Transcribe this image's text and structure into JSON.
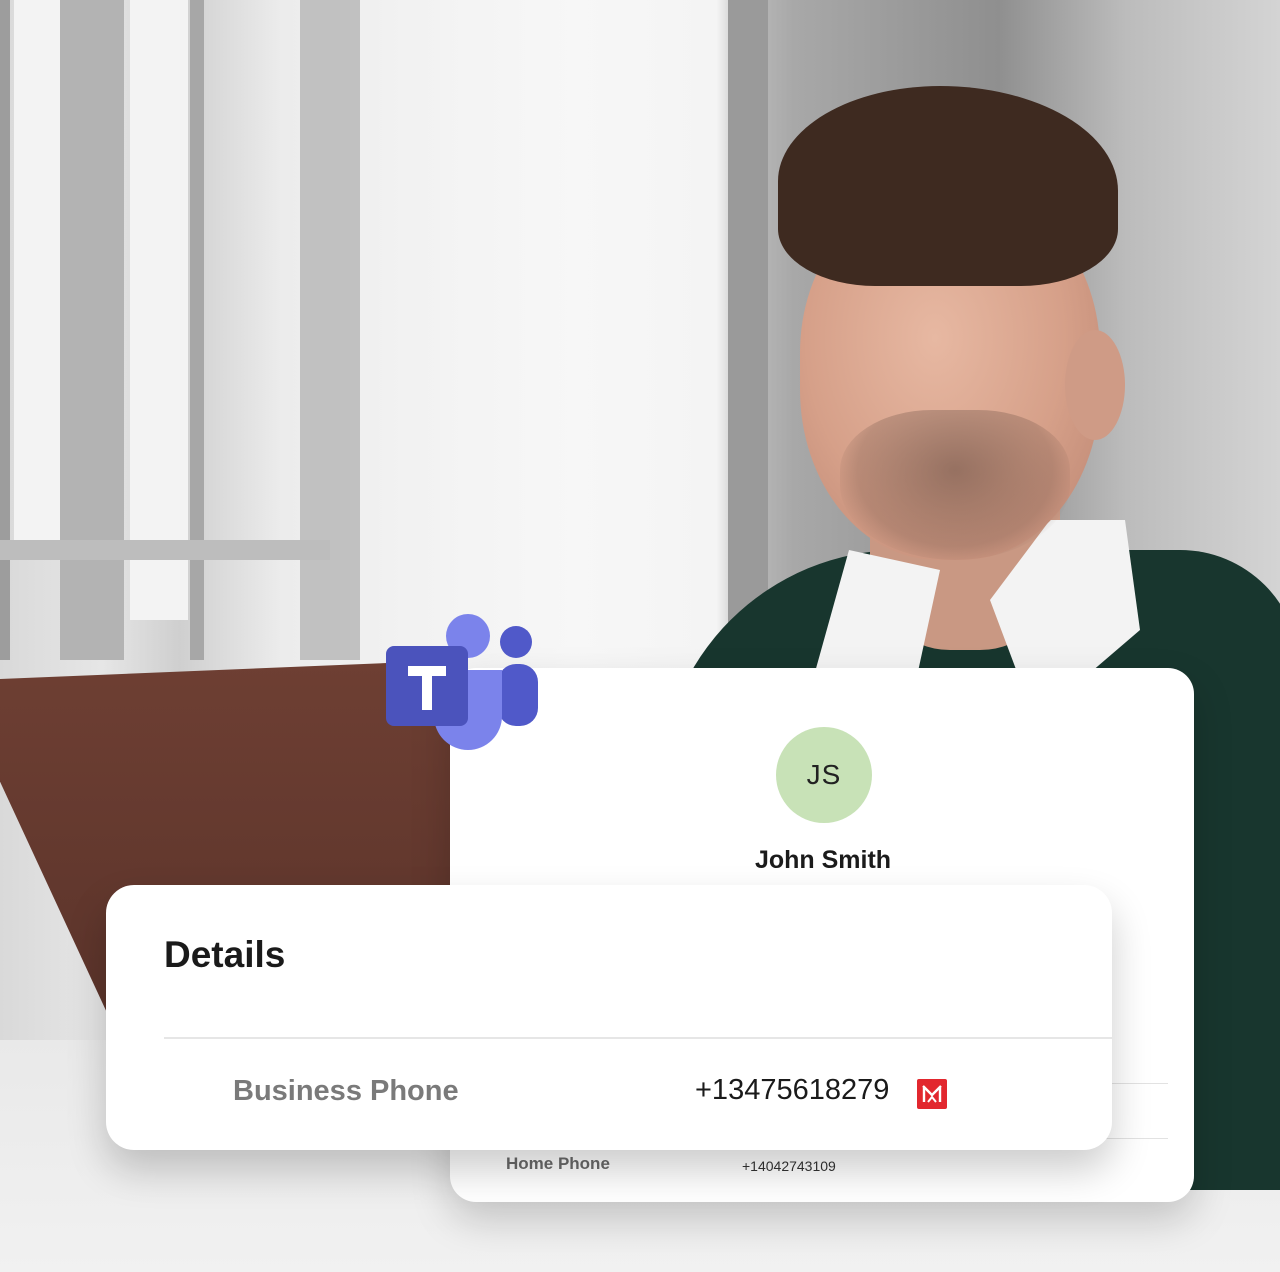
{
  "app": {
    "logo_icon": "microsoft-teams-icon",
    "brand_colors": {
      "teams_dark": "#4b53bc",
      "teams_light": "#7b83eb",
      "call_icon": "#e2272e",
      "avatar_bg": "#c8e2b7"
    }
  },
  "contact": {
    "initials": "JS",
    "name": "John Smith"
  },
  "details": {
    "title": "Details",
    "rows": [
      {
        "label": "Business Phone",
        "value": "+13475618279",
        "action_icon": "call-icon"
      }
    ]
  },
  "back_card": {
    "rows": [
      {
        "label": "Home Phone",
        "value": "+14042743109"
      }
    ]
  }
}
